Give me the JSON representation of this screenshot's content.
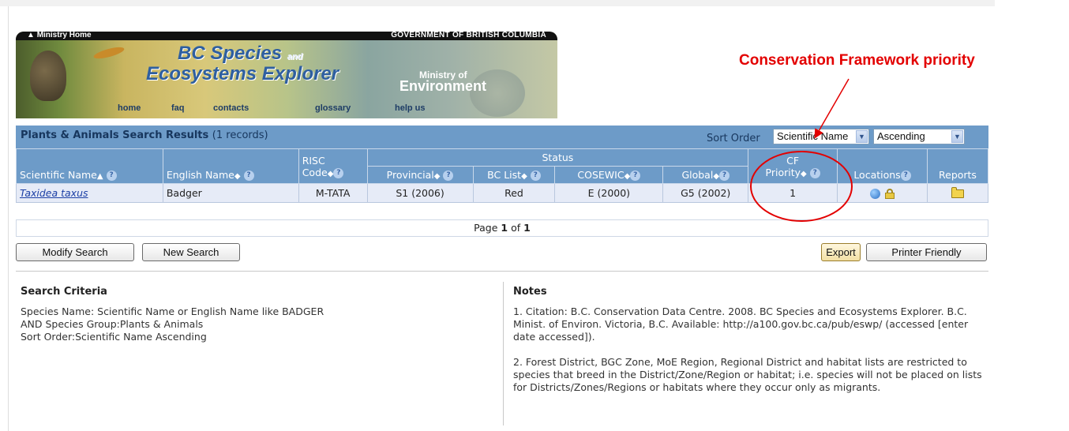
{
  "banner": {
    "ministry_home": "Ministry Home",
    "government": "GOVERNMENT OF BRITISH COLUMBIA",
    "title_line1": "BC Species",
    "title_and": "and",
    "title_line2": "Ecosystems Explorer",
    "ministry_of": "Ministry of",
    "environment": "Environment",
    "nav": [
      "home",
      "faq",
      "contacts",
      "glossary",
      "help us"
    ]
  },
  "callout": "Conservation Framework priority",
  "results": {
    "title": "Plants & Animals Search Results",
    "count": "(1 records)",
    "sort_order_label": "Sort Order",
    "sort_field": "Scientific Name",
    "sort_direction": "Ascending"
  },
  "table": {
    "group_header": "Status",
    "headers": {
      "scientific": "Scientific Name",
      "english": "English Name",
      "risc_top": "RISC",
      "risc_bottom": "Code",
      "provincial": "Provincial",
      "bclist": "BC List",
      "cosewic": "COSEWIC",
      "global": "Global",
      "cf_top": "CF",
      "cf_bottom": "Priority",
      "locations": "Locations",
      "reports": "Reports"
    },
    "rows": [
      {
        "scientific": "Taxidea taxus",
        "english": "Badger",
        "risc": "M-TATA",
        "provincial": "S1 (2006)",
        "bclist": "Red",
        "cosewic": "E (2000)",
        "global": "G5 (2002)",
        "cf_priority": "1"
      }
    ]
  },
  "pager": {
    "prefix": "Page",
    "current": "1",
    "of": "of",
    "total": "1"
  },
  "buttons": {
    "modify": "Modify Search",
    "new": "New Search",
    "export": "Export",
    "printer": "Printer Friendly"
  },
  "criteria": {
    "title": "Search Criteria",
    "lines": [
      "Species Name: Scientific Name or English Name like BADGER",
      "AND Species Group:Plants & Animals",
      "Sort Order:Scientific Name Ascending"
    ]
  },
  "notes": {
    "title": "Notes",
    "items": [
      "1. Citation: B.C. Conservation Data Centre. 2008. BC Species and Ecosystems Explorer. B.C. Minist. of Environ. Victoria, B.C. Available: http://a100.gov.bc.ca/pub/eswp/ (accessed [enter date accessed]).",
      "2. Forest District, BGC Zone, MoE Region, Regional District and habitat lists are restricted to species that breed in the District/Zone/Region or habitat; i.e. species will not be placed on lists for Districts/Zones/Regions or habitats where they occur only as migrants."
    ]
  },
  "colors": {
    "header_blue": "#6d9bc8",
    "row_bg": "#e6ebf7",
    "annotation_red": "#e30000"
  }
}
